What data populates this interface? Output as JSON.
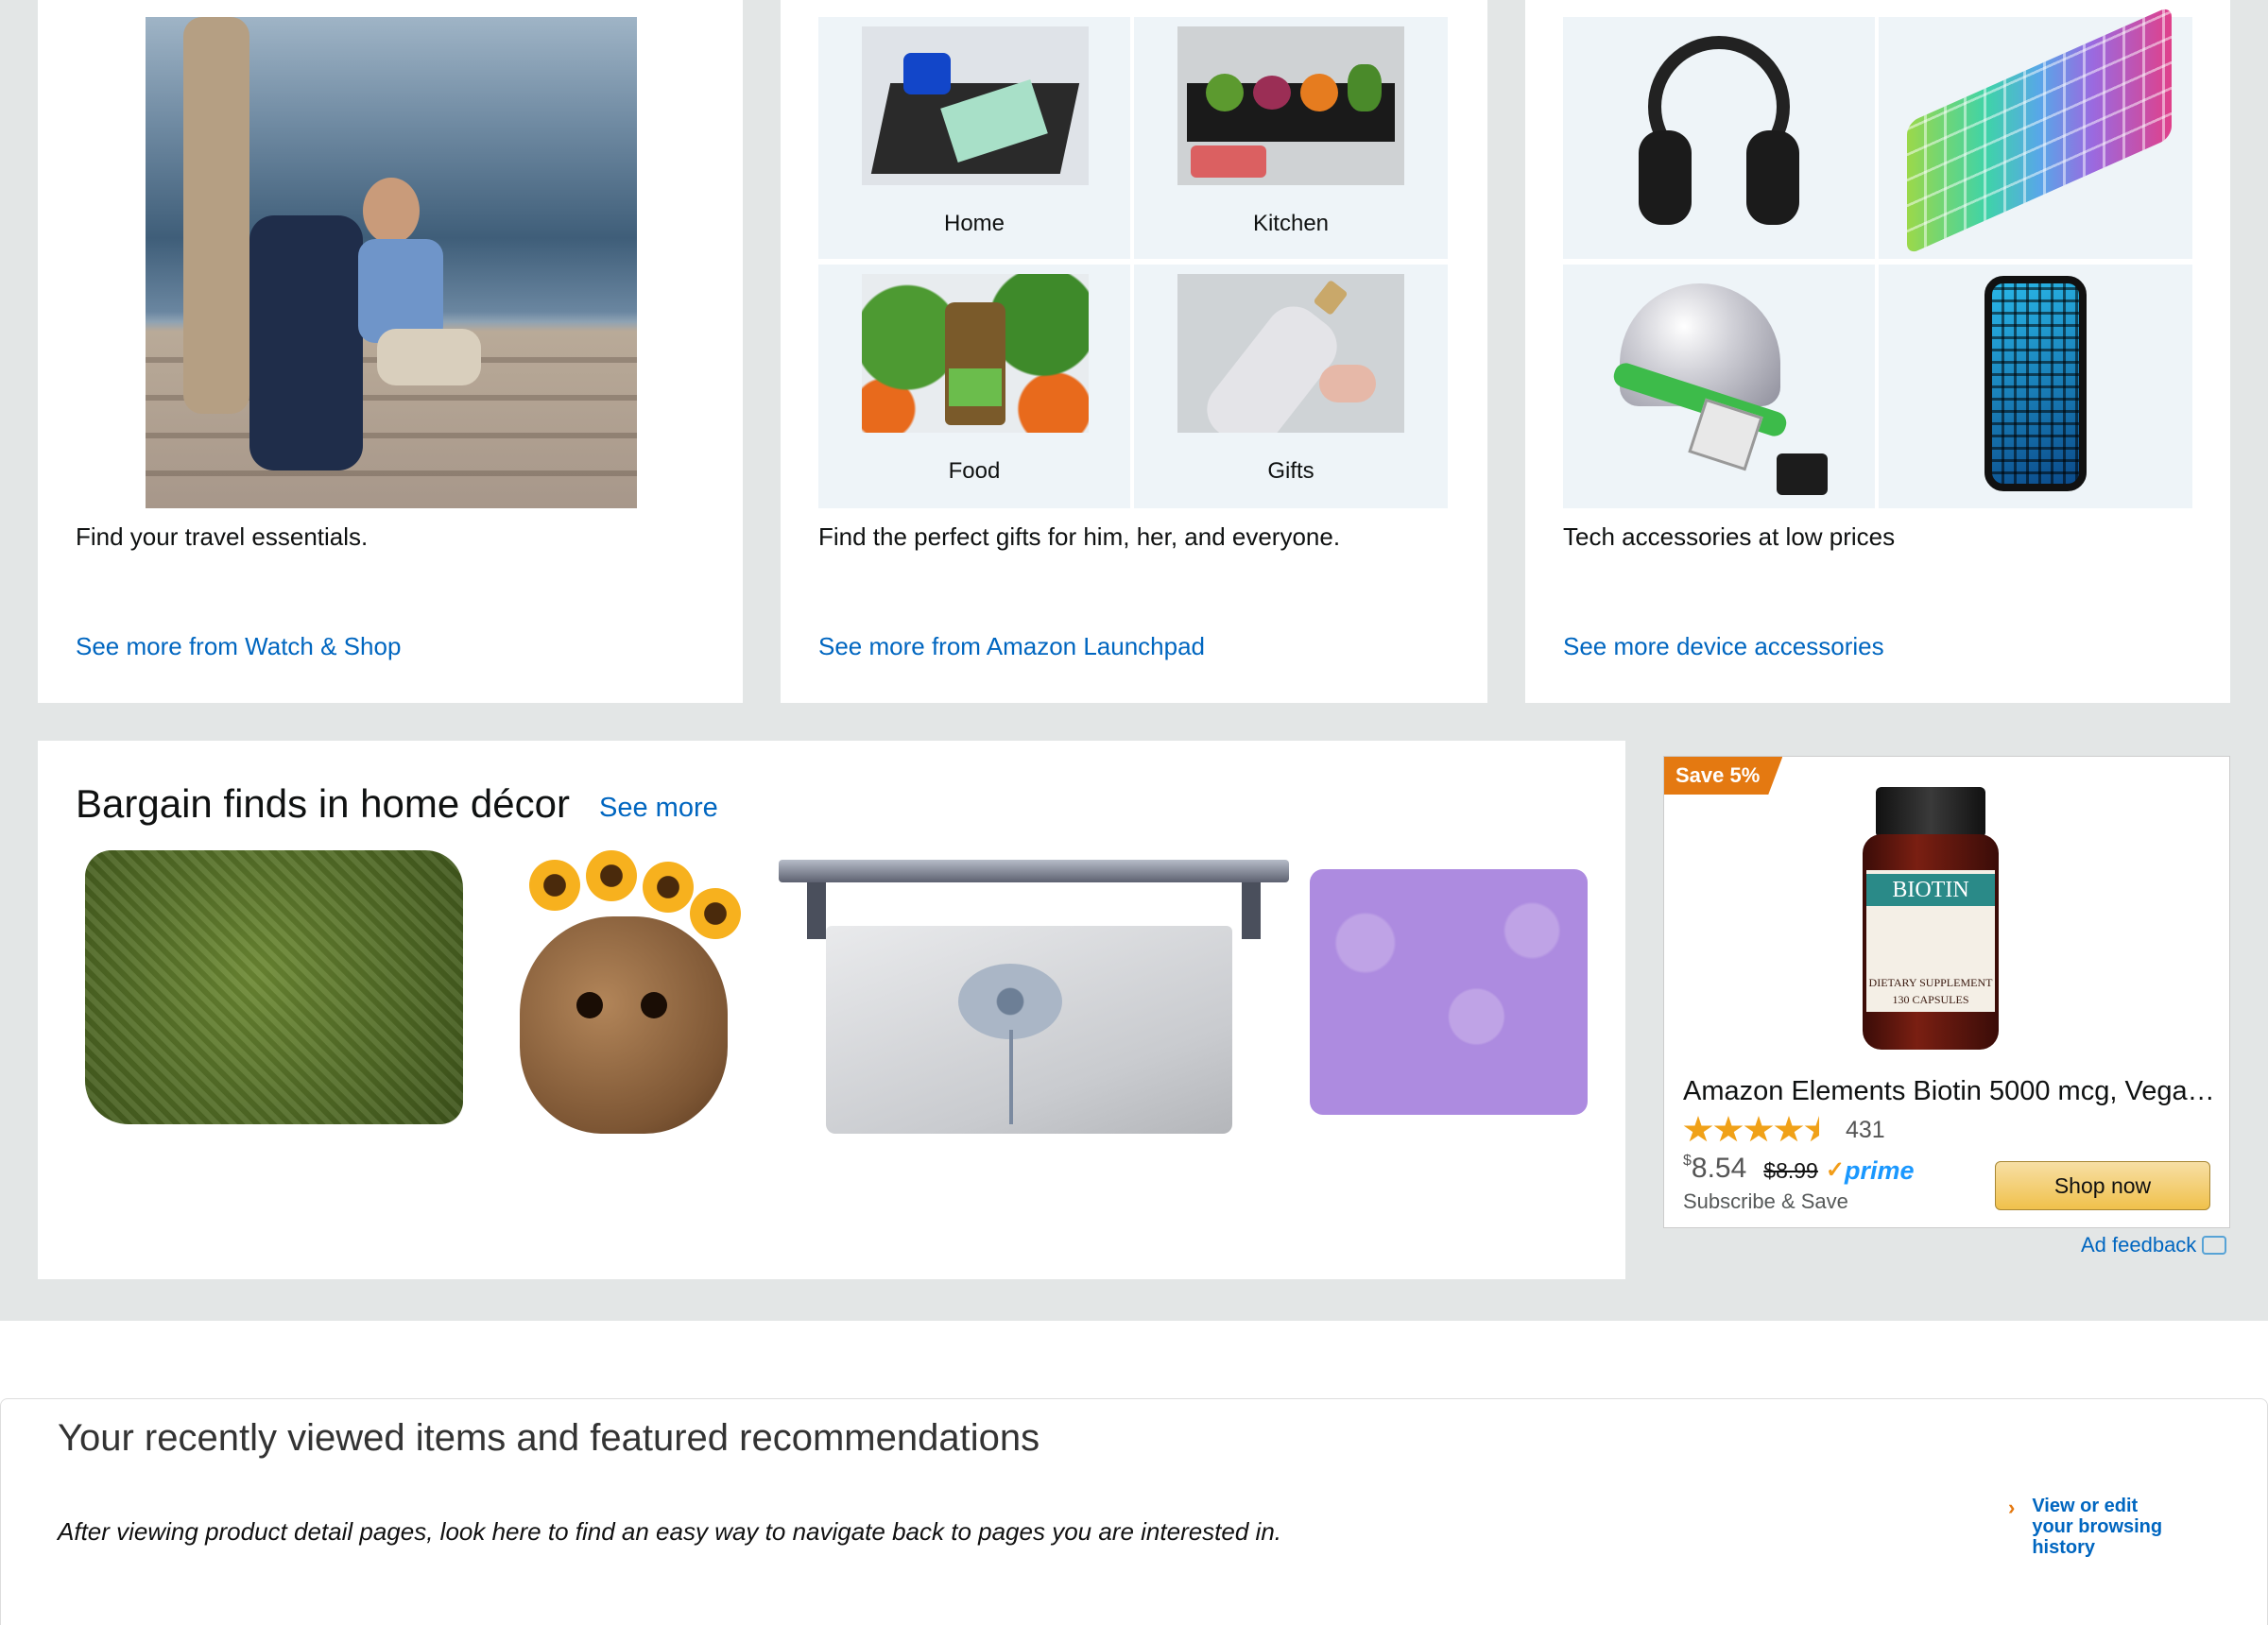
{
  "cards": {
    "travel": {
      "caption": "Find your travel essentials.",
      "link": "See more from Watch & Shop"
    },
    "launchpad": {
      "tiles": [
        "Home",
        "Kitchen",
        "Food",
        "Gifts"
      ],
      "caption": "Find the perfect gifts for him, her, and everyone.",
      "link": "See more from Amazon Launchpad"
    },
    "tech": {
      "caption": "Tech accessories at low prices",
      "link": "See more device accessories"
    }
  },
  "bargain": {
    "title": "Bargain finds in home décor",
    "see_more": "See more"
  },
  "ad": {
    "badge": "Save 5%",
    "product_title": "Amazon Elements Biotin 5000 mcg, Vega…",
    "bottle_label": "BIOTIN",
    "bottle_sub": "DIETARY SUPPLEMENT",
    "bottle_count": "130 CAPSULES",
    "rating": 4.5,
    "review_count": "431",
    "price_symbol": "$",
    "price": "8.54",
    "list_price": "$8.99",
    "prime": "prime",
    "subscribe": "Subscribe & Save",
    "shop_now": "Shop now",
    "feedback": "Ad feedback"
  },
  "recent": {
    "title": "Your recently viewed items and featured recommendations",
    "text": "After viewing product detail pages, look here to find an easy way to navigate back to pages you are interested in.",
    "history_link": "View or edit your browsing history"
  },
  "colors": {
    "link": "#0066c0",
    "badge": "#e47911",
    "star": "#f0a118",
    "button": "#f0c14b",
    "background": "#e3e6e6"
  }
}
